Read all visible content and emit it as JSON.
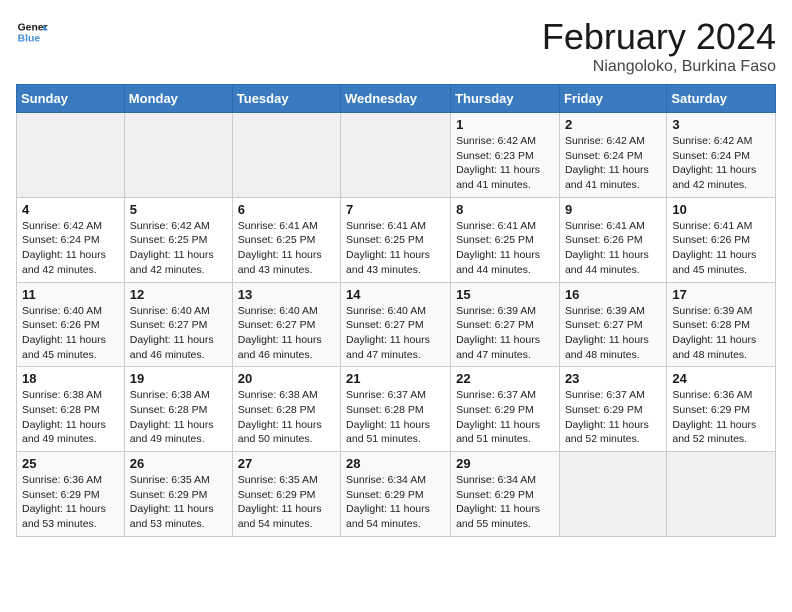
{
  "logo": {
    "line1": "General",
    "line2": "Blue"
  },
  "title": "February 2024",
  "subtitle": "Niangoloko, Burkina Faso",
  "days_of_week": [
    "Sunday",
    "Monday",
    "Tuesday",
    "Wednesday",
    "Thursday",
    "Friday",
    "Saturday"
  ],
  "weeks": [
    [
      {
        "day": "",
        "info": ""
      },
      {
        "day": "",
        "info": ""
      },
      {
        "day": "",
        "info": ""
      },
      {
        "day": "",
        "info": ""
      },
      {
        "day": "1",
        "info": "Sunrise: 6:42 AM\nSunset: 6:23 PM\nDaylight: 11 hours and 41 minutes."
      },
      {
        "day": "2",
        "info": "Sunrise: 6:42 AM\nSunset: 6:24 PM\nDaylight: 11 hours and 41 minutes."
      },
      {
        "day": "3",
        "info": "Sunrise: 6:42 AM\nSunset: 6:24 PM\nDaylight: 11 hours and 42 minutes."
      }
    ],
    [
      {
        "day": "4",
        "info": "Sunrise: 6:42 AM\nSunset: 6:24 PM\nDaylight: 11 hours and 42 minutes."
      },
      {
        "day": "5",
        "info": "Sunrise: 6:42 AM\nSunset: 6:25 PM\nDaylight: 11 hours and 42 minutes."
      },
      {
        "day": "6",
        "info": "Sunrise: 6:41 AM\nSunset: 6:25 PM\nDaylight: 11 hours and 43 minutes."
      },
      {
        "day": "7",
        "info": "Sunrise: 6:41 AM\nSunset: 6:25 PM\nDaylight: 11 hours and 43 minutes."
      },
      {
        "day": "8",
        "info": "Sunrise: 6:41 AM\nSunset: 6:25 PM\nDaylight: 11 hours and 44 minutes."
      },
      {
        "day": "9",
        "info": "Sunrise: 6:41 AM\nSunset: 6:26 PM\nDaylight: 11 hours and 44 minutes."
      },
      {
        "day": "10",
        "info": "Sunrise: 6:41 AM\nSunset: 6:26 PM\nDaylight: 11 hours and 45 minutes."
      }
    ],
    [
      {
        "day": "11",
        "info": "Sunrise: 6:40 AM\nSunset: 6:26 PM\nDaylight: 11 hours and 45 minutes."
      },
      {
        "day": "12",
        "info": "Sunrise: 6:40 AM\nSunset: 6:27 PM\nDaylight: 11 hours and 46 minutes."
      },
      {
        "day": "13",
        "info": "Sunrise: 6:40 AM\nSunset: 6:27 PM\nDaylight: 11 hours and 46 minutes."
      },
      {
        "day": "14",
        "info": "Sunrise: 6:40 AM\nSunset: 6:27 PM\nDaylight: 11 hours and 47 minutes."
      },
      {
        "day": "15",
        "info": "Sunrise: 6:39 AM\nSunset: 6:27 PM\nDaylight: 11 hours and 47 minutes."
      },
      {
        "day": "16",
        "info": "Sunrise: 6:39 AM\nSunset: 6:27 PM\nDaylight: 11 hours and 48 minutes."
      },
      {
        "day": "17",
        "info": "Sunrise: 6:39 AM\nSunset: 6:28 PM\nDaylight: 11 hours and 48 minutes."
      }
    ],
    [
      {
        "day": "18",
        "info": "Sunrise: 6:38 AM\nSunset: 6:28 PM\nDaylight: 11 hours and 49 minutes."
      },
      {
        "day": "19",
        "info": "Sunrise: 6:38 AM\nSunset: 6:28 PM\nDaylight: 11 hours and 49 minutes."
      },
      {
        "day": "20",
        "info": "Sunrise: 6:38 AM\nSunset: 6:28 PM\nDaylight: 11 hours and 50 minutes."
      },
      {
        "day": "21",
        "info": "Sunrise: 6:37 AM\nSunset: 6:28 PM\nDaylight: 11 hours and 51 minutes."
      },
      {
        "day": "22",
        "info": "Sunrise: 6:37 AM\nSunset: 6:29 PM\nDaylight: 11 hours and 51 minutes."
      },
      {
        "day": "23",
        "info": "Sunrise: 6:37 AM\nSunset: 6:29 PM\nDaylight: 11 hours and 52 minutes."
      },
      {
        "day": "24",
        "info": "Sunrise: 6:36 AM\nSunset: 6:29 PM\nDaylight: 11 hours and 52 minutes."
      }
    ],
    [
      {
        "day": "25",
        "info": "Sunrise: 6:36 AM\nSunset: 6:29 PM\nDaylight: 11 hours and 53 minutes."
      },
      {
        "day": "26",
        "info": "Sunrise: 6:35 AM\nSunset: 6:29 PM\nDaylight: 11 hours and 53 minutes."
      },
      {
        "day": "27",
        "info": "Sunrise: 6:35 AM\nSunset: 6:29 PM\nDaylight: 11 hours and 54 minutes."
      },
      {
        "day": "28",
        "info": "Sunrise: 6:34 AM\nSunset: 6:29 PM\nDaylight: 11 hours and 54 minutes."
      },
      {
        "day": "29",
        "info": "Sunrise: 6:34 AM\nSunset: 6:29 PM\nDaylight: 11 hours and 55 minutes."
      },
      {
        "day": "",
        "info": ""
      },
      {
        "day": "",
        "info": ""
      }
    ]
  ]
}
